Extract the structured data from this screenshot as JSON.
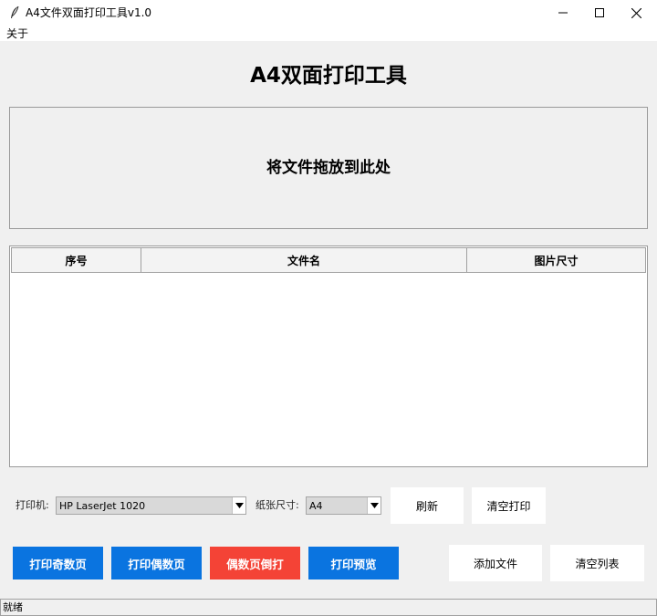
{
  "window": {
    "title": "A4文件双面打印工具v1.0"
  },
  "menu": {
    "items": [
      "关于"
    ]
  },
  "heading": "A4双面打印工具",
  "dropzone": {
    "text": "将文件拖放到此处"
  },
  "table": {
    "columns": [
      "序号",
      "文件名",
      "图片尺寸"
    ],
    "rows": []
  },
  "printer": {
    "label": "打印机:",
    "value": "HP LaserJet 1020"
  },
  "paper": {
    "label": "纸张尺寸:",
    "value": "A4"
  },
  "buttons": {
    "refresh": "刷新",
    "clear_print": "清空打印",
    "print_odd": "打印奇数页",
    "print_even": "打印偶数页",
    "even_reverse": "偶数页倒打",
    "print_preview": "打印预览",
    "add_file": "添加文件",
    "clear_list": "清空列表"
  },
  "colors": {
    "primary": "#0a74e0",
    "danger": "#f44336"
  },
  "status": "就绪"
}
